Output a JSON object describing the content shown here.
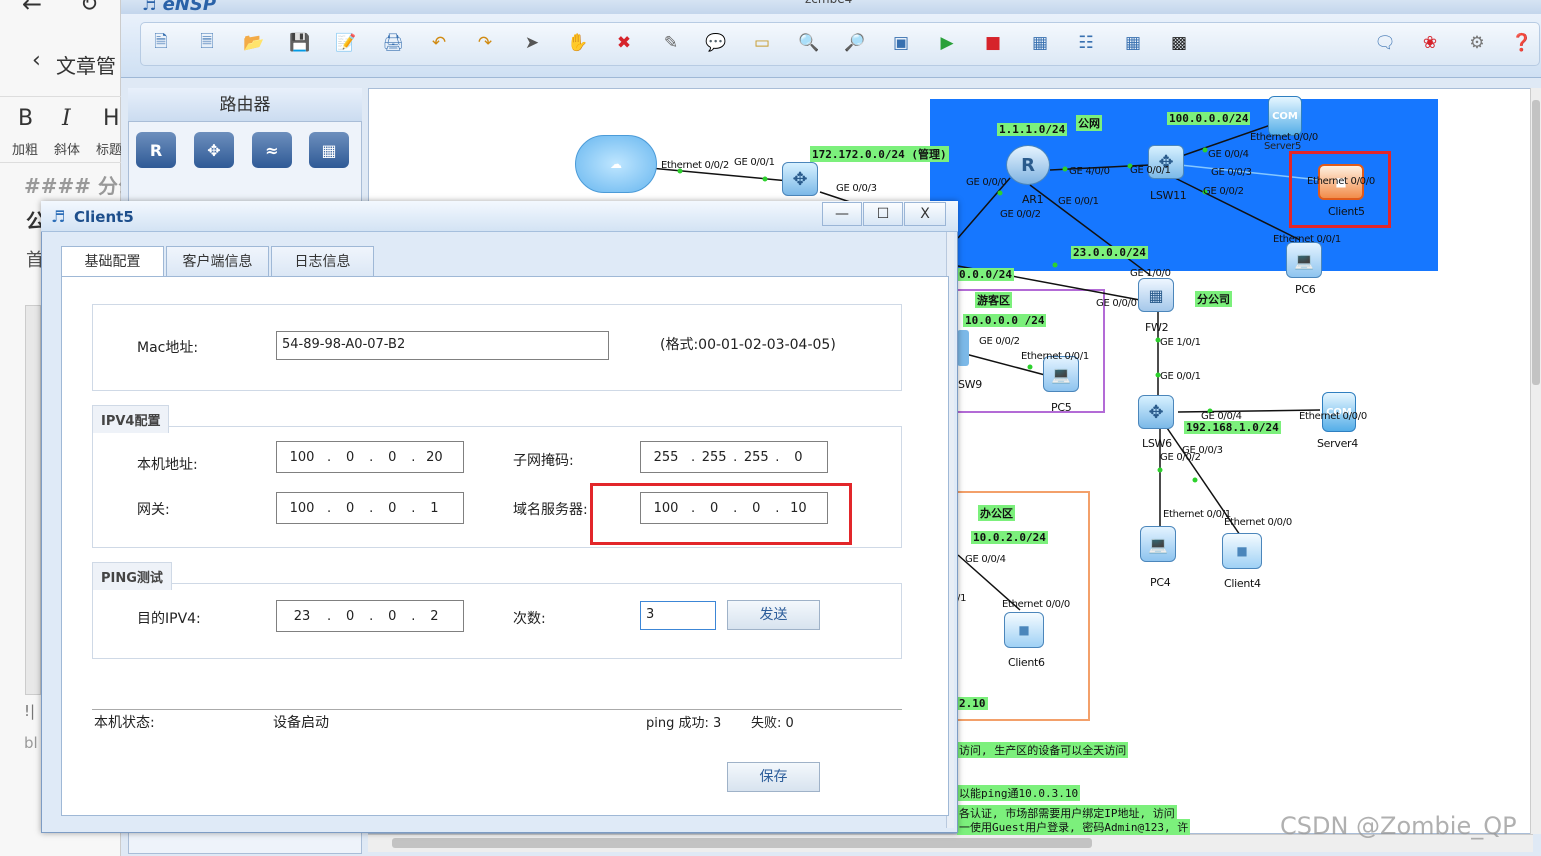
{
  "browser": {
    "back_glyph": "←",
    "reload_glyph": "↻",
    "article_manage": "文章管",
    "editor": {
      "bold_glyph": "B",
      "italic_glyph": "I",
      "heading_glyph": "H",
      "bold_label": "加粗",
      "italic_label": "斜体",
      "heading_label": "标题",
      "markdown_line": "#### 分公",
      "line2": "公",
      "line3": "首",
      "side_text_1": "!|",
      "side_text_2": "bl"
    }
  },
  "app": {
    "name": "eNSP",
    "doc_title": "zcmbe4"
  },
  "palette": {
    "title": "路由器",
    "icons": [
      "router-ar-icon",
      "router-ne-icon",
      "wireless-router-icon",
      "firewall-icon"
    ]
  },
  "topology": {
    "labels": {
      "cloud_eth": "Ethernet 0/0/2",
      "cloud_ge": "GE 0/0/1",
      "sw_ge003": "GE 0/0/3",
      "net_172": "172.172.0.0/24 (管理)",
      "net_111": "1.1.1.0/24",
      "public": "公网",
      "net_100": "100.0.0.0/24",
      "server5": "Server5",
      "server5_eth": "Ethernet 0/0/0",
      "ar1_ge000": "GE 0/0/0",
      "ar1_ge400": "GE 4/0/0",
      "ar1_name": "AR1",
      "ar1_ge001": "GE 0/0/1",
      "ar1_ge002": "GE 0/0/2",
      "lsw11_ge001": "GE 0/0/1",
      "lsw11_ge004": "GE 0/0/4",
      "lsw11_ge003": "GE 0/0/3",
      "lsw11_ge002": "GE 0/0/2",
      "lsw11": "LSW11",
      "client5_eth": "Ethernet 0/0/0",
      "client5": "Client5",
      "pc6_eth": "Ethernet 0/0/1",
      "pc6": "PC6",
      "net_23": "23.0.0.0/24",
      "net_x": "0.0.0/24",
      "fw_ge100": "GE 1/0/0",
      "fw_ge000": "GE 0/0/0",
      "fw2": "FW2",
      "branch": "分公司",
      "fw_ge101": "GE 1/0/1",
      "guest": "游客区",
      "net_10_0": "10.0.0.0 /24",
      "sw9_ge002": "GE 0/0/2",
      "pc5_eth": "Ethernet 0/0/1",
      "sw9": "SW9",
      "pc5": "PC5",
      "lsw6_ge001": "GE 0/0/1",
      "lsw6_ge004": "GE 0/0/4",
      "net_192": "192.168.1.0/24",
      "server4_eth": "Ethernet 0/0/0",
      "server4": "Server4",
      "lsw6": "LSW6",
      "lsw6_ge003": "GE 0/0/3",
      "lsw6_ge002": "GE 0/0/2",
      "pc4_eth": "Ethernet 0/0/1",
      "client4_eth": "Ethernet 0/0/0",
      "pc4": "PC4",
      "client4": "Client4",
      "office": "办公区",
      "net_10_2": "10.0.2.0/24",
      "office_ge004": "GE 0/0/4",
      "client6_eth": "Ethernet 0/0/0",
      "client6": "Client6",
      "office_v1": "/1",
      "office_ip": "2.10",
      "note1": "访问, 生产区的设备可以全天访问",
      "note2": "以能ping通10.0.3.10",
      "note3": "各认证, 市场部需要用户绑定IP地址, 访问",
      "note4": "一使用Guest用户登录, 密码Admin@123, 许"
    }
  },
  "dialog": {
    "title": "Client5",
    "minimize_glyph": "—",
    "maximize_glyph": "☐",
    "close_glyph": "X",
    "tabs": [
      "基础配置",
      "客户端信息",
      "日志信息"
    ],
    "mac_label": "Mac地址:",
    "mac_value": "54-89-98-A0-07-B2",
    "mac_hint": "(格式:00-01-02-03-04-05)",
    "ipv4_section": "IPV4配置",
    "local_ip_label": "本机地址:",
    "local_ip": [
      "100",
      "0",
      "0",
      "20"
    ],
    "mask_label": "子网掩码:",
    "mask": [
      "255",
      "255",
      "255",
      "0"
    ],
    "gateway_label": "网关:",
    "gateway": [
      "100",
      "0",
      "0",
      "1"
    ],
    "dns_label": "域名服务器:",
    "dns": [
      "100",
      "0",
      "0",
      "10"
    ],
    "ping_section": "PING测试",
    "dest_label": "目的IPV4:",
    "dest": [
      "23",
      "0",
      "0",
      "2"
    ],
    "count_label": "次数:",
    "count_value": "3",
    "send_label": "发送",
    "status_label": "本机状态:",
    "status_value": "设备启动",
    "ping_success": "ping 成功: 3",
    "ping_fail": "失败: 0",
    "save_label": "保存"
  },
  "watermark": "CSDN @Zombie_QP",
  "colors": {
    "highlight": "#e2262a",
    "public_zone": "#1677ff",
    "guest_zone": "#b36bd6",
    "office_zone": "#f3a06a",
    "label_green": "#7cf07c"
  }
}
